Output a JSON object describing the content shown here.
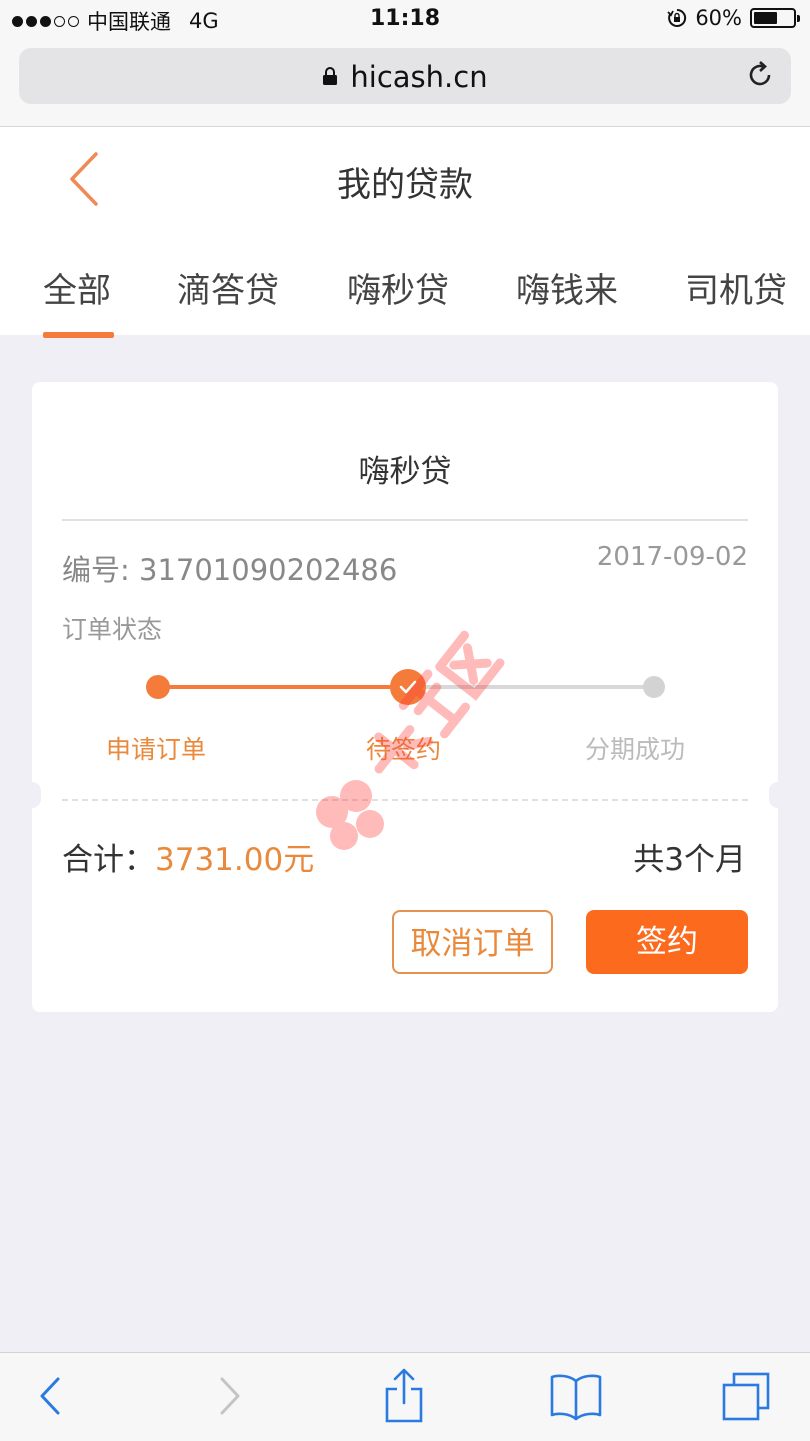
{
  "status_bar": {
    "carrier": "中国联通",
    "network": "4G",
    "time": "11:18",
    "battery": "60%",
    "battery_level": 0.6
  },
  "browser": {
    "url": "hicash.cn"
  },
  "header": {
    "title": "我的贷款",
    "tabs": [
      {
        "label": "全部",
        "active": true
      },
      {
        "label": "滴答贷"
      },
      {
        "label": "嗨秒贷"
      },
      {
        "label": "嗨钱来"
      },
      {
        "label": "司机贷"
      }
    ]
  },
  "card": {
    "product": "嗨秒贷",
    "order_number": "编号: 31701090202486",
    "date": "2017-09-02",
    "status_label": "订单状态",
    "steps": [
      {
        "label": "申请订单",
        "state": "done"
      },
      {
        "label": "待签约",
        "state": "current"
      },
      {
        "label": "分期成功",
        "state": "pending"
      }
    ],
    "total_label": "合计：",
    "total_value": "3731.00元",
    "term": "共3个月",
    "cancel_button": "取消订单",
    "sign_button": "签约"
  },
  "colors": {
    "accent": "#f47b3a",
    "button": "#fb6a1d",
    "background": "#f0eff5"
  }
}
